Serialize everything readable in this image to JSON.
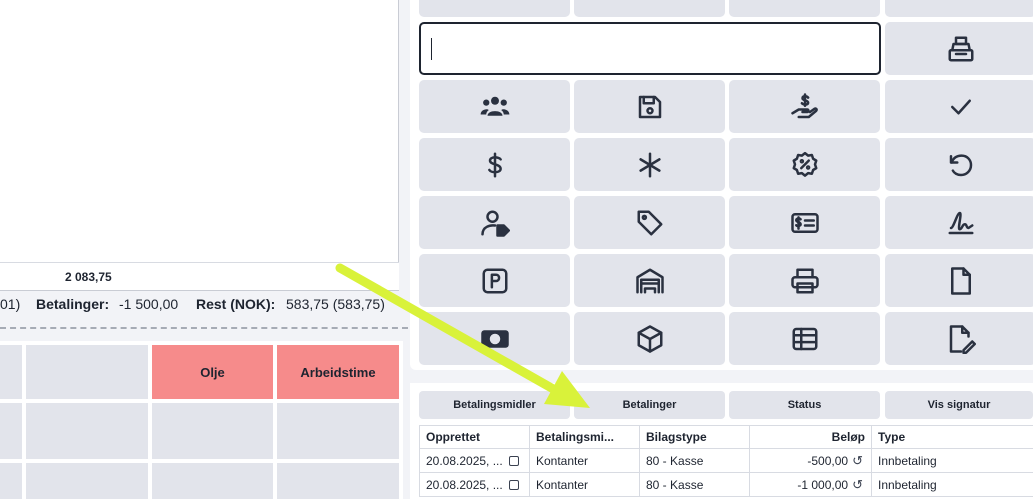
{
  "left": {
    "sum_value": "2 083,75",
    "totals": {
      "prefix": "01)",
      "payments_label": "Betalinger:",
      "payments_value": "-1 500,00",
      "rest_label": "Rest (NOK):",
      "rest_value": "583,75 (583,75)"
    },
    "grid_labels": [
      "Olje",
      "Arbeidstime"
    ]
  },
  "keypad": {
    "input_value": "",
    "buttons": [
      "register-icon",
      "customers-icon",
      "save-icon",
      "cash-in-hand-icon",
      "checkmark-icon",
      "dollar-icon",
      "asterisk-icon",
      "discount-icon",
      "undo-icon",
      "customer-tag-icon",
      "tag-icon",
      "card-icon",
      "signature-icon",
      "parking-icon",
      "garage-icon",
      "printer-icon",
      "document-icon",
      "banknote-icon",
      "box-icon",
      "table-icon",
      "edit-document-icon"
    ]
  },
  "payments": {
    "tabs": [
      "Betalingsmidler",
      "Betalinger",
      "Status",
      "Vis signatur"
    ],
    "columns": [
      "Opprettet",
      "Betalingsmi...",
      "Bilagstype",
      "Beløp",
      "Type"
    ],
    "rows": [
      {
        "created": "20.08.2025, ...",
        "method": "Kontanter",
        "voucher": "80 - Kasse",
        "amount": "-500,00",
        "type": "Innbetaling"
      },
      {
        "created": "20.08.2025, ...",
        "method": "Kontanter",
        "voucher": "80 - Kasse",
        "amount": "-1 000,00",
        "type": "Innbetaling"
      }
    ]
  },
  "colors": {
    "accent_red": "#f68b8b",
    "button_bg": "#e2e4eb",
    "arrow": "#d9f23a"
  }
}
